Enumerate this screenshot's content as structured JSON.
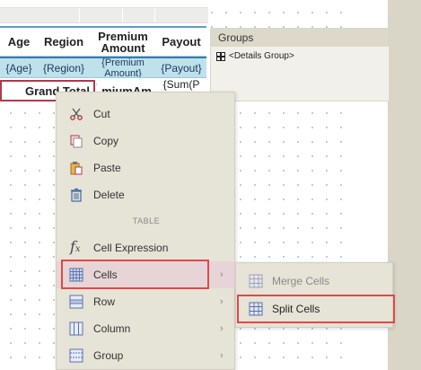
{
  "table": {
    "headers": [
      "Age",
      "Region",
      "Premium Amount",
      "Payout"
    ],
    "details": [
      "{Age}",
      "{Region}",
      "{Premium Amount}",
      "{Payout}"
    ],
    "total_label": "Grand Total",
    "total_cells": [
      "miumAm",
      "{Sum(P"
    ]
  },
  "groups": {
    "title": "Groups",
    "item": "<Details Group>"
  },
  "menu": {
    "items": [
      {
        "label": "Cut",
        "icon": "scissors-icon"
      },
      {
        "label": "Copy",
        "icon": "copy-icon"
      },
      {
        "label": "Paste",
        "icon": "paste-icon"
      },
      {
        "label": "Delete",
        "icon": "trash-icon"
      }
    ],
    "section": "TABLE",
    "table_items": [
      {
        "label": "Cell Expression",
        "icon": "function-icon"
      },
      {
        "label": "Cells",
        "icon": "cells-grid-icon",
        "arrow": "›"
      },
      {
        "label": "Row",
        "icon": "row-icon",
        "arrow": "›"
      },
      {
        "label": "Column",
        "icon": "column-icon",
        "arrow": "›"
      },
      {
        "label": "Group",
        "icon": "group-icon",
        "arrow": "›"
      }
    ]
  },
  "submenu": {
    "items": [
      {
        "label": "Merge Cells",
        "icon": "merge-cells-icon",
        "disabled": true
      },
      {
        "label": "Split Cells",
        "icon": "split-cells-icon",
        "disabled": false
      }
    ]
  },
  "colors": {
    "highlight_border": "#e04848",
    "detail_row_bg": "#bfe1ec",
    "menu_bg": "#e6e3d7"
  }
}
